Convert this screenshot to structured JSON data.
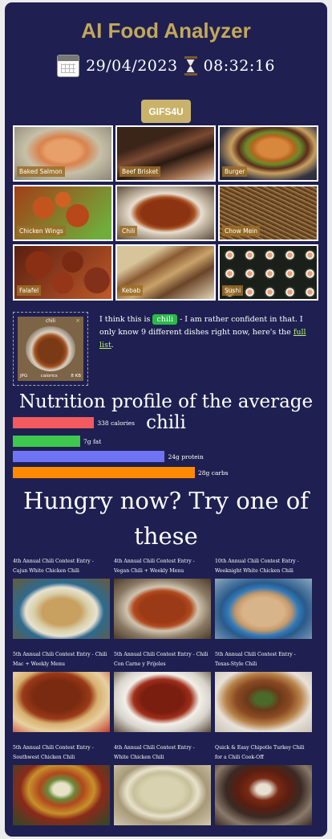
{
  "app": {
    "title": "AI Food Analyzer",
    "date": "29/04/2023",
    "time": "08:32:16",
    "gifs_button": "GIFS4U"
  },
  "foods": [
    {
      "label": "Baked Salmon",
      "icon": "baked-salmon-photo"
    },
    {
      "label": "Beef Brisket",
      "icon": "beef-brisket-photo"
    },
    {
      "label": "Burger",
      "icon": "burger-photo"
    },
    {
      "label": "Chicken Wings",
      "icon": "chicken-wings-photo"
    },
    {
      "label": "Chili",
      "icon": "chili-photo"
    },
    {
      "label": "Chow Mein",
      "icon": "chow-mein-photo"
    },
    {
      "label": "Falafel",
      "icon": "falafel-photo"
    },
    {
      "label": "Kebab",
      "icon": "kebab-photo"
    },
    {
      "label": "Sushi",
      "icon": "sushi-photo"
    }
  ],
  "prediction": {
    "card_name": "chili",
    "close": "×",
    "file_type": "JPG",
    "file_name": "calorics",
    "file_size": "8 KB",
    "text_before": "I think this is",
    "dish": "chili",
    "text_after": "- I am rather confident in that. I only know 9 different dishes right now, here's the",
    "link": "full list",
    "text_end": "."
  },
  "nutrition": {
    "title": "Nutrition profile of the average chili",
    "bars": [
      {
        "label": "338 calories",
        "value": 338,
        "max": 1000,
        "color": "#f25a5f"
      },
      {
        "label": "7g fat",
        "value": 7,
        "max": 25,
        "color": "#3ec84f"
      },
      {
        "label": "24g protein",
        "value": 24,
        "max": 38,
        "color": "#6f74f5"
      },
      {
        "label": "28g carbs",
        "value": 28,
        "max": 37,
        "color": "#ff8a00"
      }
    ]
  },
  "hungry": {
    "title": "Hungry now? Try one of these"
  },
  "recipes": [
    {
      "title": "4th Annual Chili Contest Entry - Cajun White Chicken Chili"
    },
    {
      "title": "4th Annual Chili Contest Entry - Vegan Chili + Weekly Menu"
    },
    {
      "title": "10th Annual Chili Contest Entry - Weeknight White Chicken Chili"
    },
    {
      "title": "5th Annual Chili Contest Entry - Chili Mac + Weekly Menu"
    },
    {
      "title": "5th Annual Chili Contest Entry - Chili Con Carne y Frijoles"
    },
    {
      "title": "5th Annual Chili Contest Entry - Texas-Style Chili"
    },
    {
      "title": "5th Annual Chili Contest Entry - Southwest Chicken Chili"
    },
    {
      "title": "4th Annual Chili Contest Entry - White Chicken Chili"
    },
    {
      "title": "Quick & Easy Chipotle Turkey Chili for a Chili Cook-Off"
    }
  ],
  "colors": {
    "background": "#1f2051",
    "title": "#c2a859",
    "button": "#c9b36a",
    "badge": "#2bb84a",
    "link": "#b6f36a"
  }
}
